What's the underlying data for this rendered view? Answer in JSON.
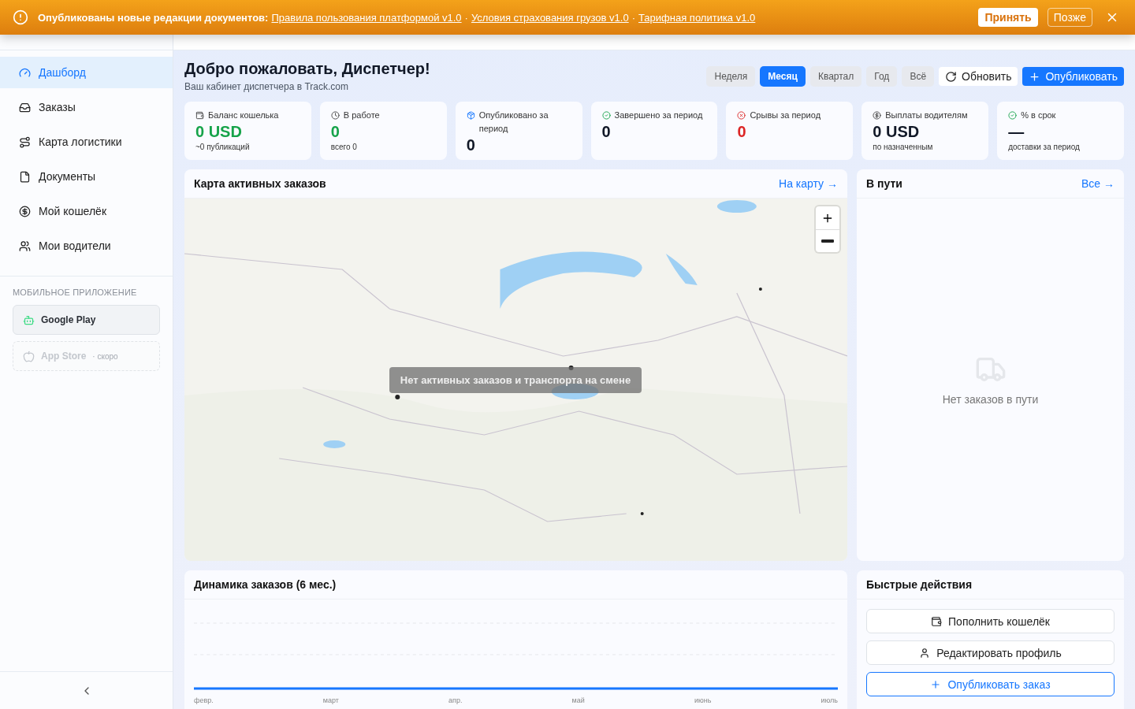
{
  "banner": {
    "title": "Опубликованы новые редакции документов:",
    "links": [
      "Правила пользования платформой v1.0",
      "Условия страхования грузов v1.0",
      "Тарифная политика v1.0"
    ],
    "separator": "·",
    "accept": "Принять",
    "later": "Позже"
  },
  "sidebar": {
    "items": [
      {
        "label": "Дашборд",
        "selected": true
      },
      {
        "label": "Заказы",
        "selected": false
      },
      {
        "label": "Карта логистики",
        "selected": false
      },
      {
        "label": "Документы",
        "selected": false
      },
      {
        "label": "Мой кошелёк",
        "selected": false
      },
      {
        "label": "Мои водители",
        "selected": false
      }
    ],
    "section_title": "МОБИЛЬНОЕ ПРИЛОЖЕНИЕ",
    "apps": [
      {
        "label": "Google Play",
        "disabled": false
      },
      {
        "label": "App Store",
        "note": "· скоро",
        "disabled": true
      }
    ]
  },
  "page": {
    "title": "Добро пожаловать, Диспетчер!",
    "subtitle": "Ваш кабинет диспетчера в Track.com",
    "periods": [
      {
        "label": "Неделя",
        "selected": false
      },
      {
        "label": "Месяц",
        "selected": true
      },
      {
        "label": "Квартал",
        "selected": false
      },
      {
        "label": "Год",
        "selected": false
      },
      {
        "label": "Всё",
        "selected": false
      }
    ],
    "refresh": "Обновить",
    "publish": "Опубликовать"
  },
  "stats": [
    {
      "label": "Баланс кошелька",
      "value": "0 USD",
      "color": "#16a34a",
      "sub": "~0 публикаций"
    },
    {
      "label": "В работе",
      "value": "0",
      "color": "#16a34a",
      "sub": "всего 0"
    },
    {
      "label": "Опубликовано за период",
      "value": "0",
      "color": "#111827"
    },
    {
      "label": "Завершено за период",
      "value": "0",
      "color": "#111827"
    },
    {
      "label": "Срывы за период",
      "value": "0",
      "color": "#dc2626"
    },
    {
      "label": "Выплаты водителям",
      "value": "0 USD",
      "color": "#111827",
      "sub": "по назначенным"
    },
    {
      "label": "% в срок",
      "value": "—",
      "color": "#111827",
      "sub": "доставки за период"
    }
  ],
  "map_card": {
    "title": "Карта активных заказов",
    "link": "На карту →",
    "overlay": "Нет активных заказов и транспорта на смене"
  },
  "transit_card": {
    "title": "В пути",
    "link": "Все →",
    "empty": "Нет заказов в пути"
  },
  "chart_card": {
    "title": "Динамика заказов (6 мес.)",
    "x_labels": [
      "февр.",
      "март",
      "апр.",
      "май",
      "июнь",
      "июль"
    ]
  },
  "actions_card": {
    "title": "Быстрые действия",
    "actions": [
      {
        "label": "Пополнить кошелёк",
        "primary": false
      },
      {
        "label": "Редактировать профиль",
        "primary": false
      },
      {
        "label": "Опубликовать заказ",
        "primary": true
      }
    ]
  }
}
